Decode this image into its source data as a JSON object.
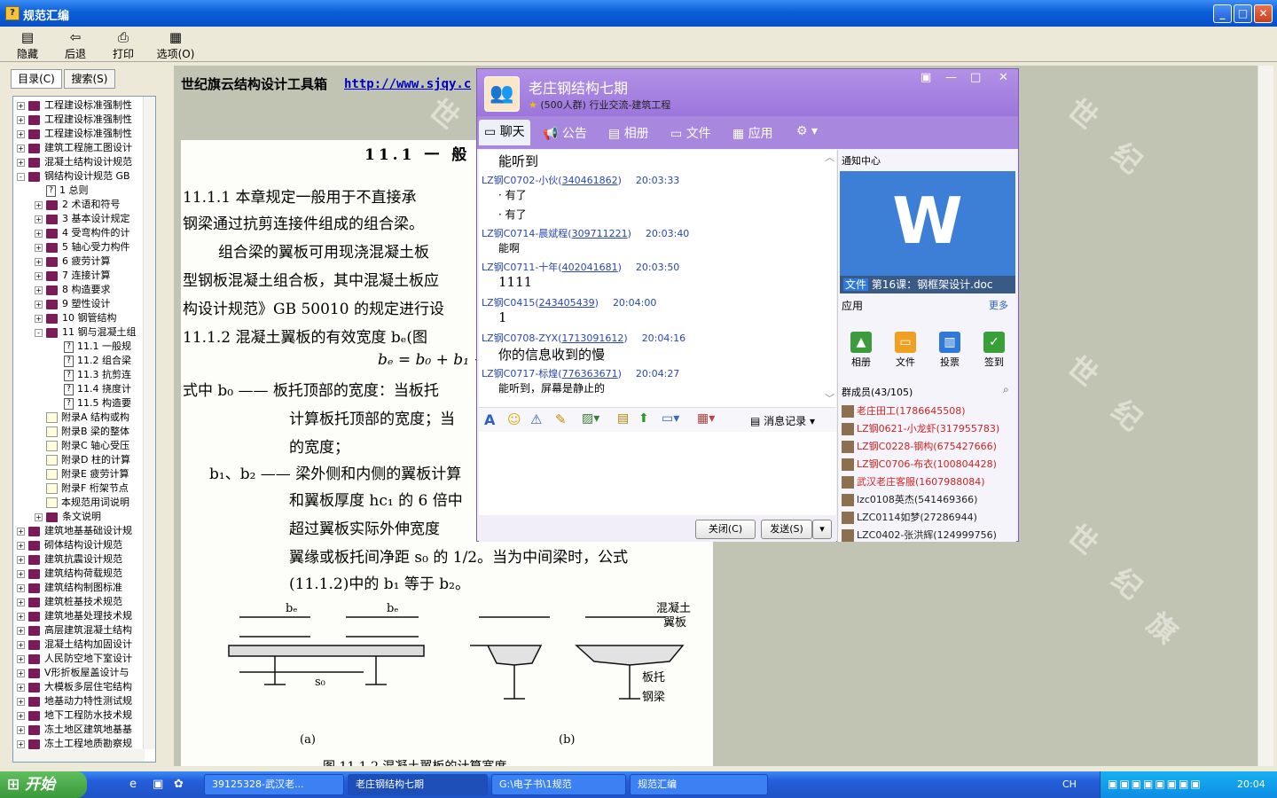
{
  "window": {
    "title": "规范汇编"
  },
  "toolbar": {
    "hide": "隐藏",
    "back": "后退",
    "print": "打印",
    "options": "选项(O)"
  },
  "left_tabs": {
    "contents": "目录(C)",
    "search": "搜索(S)"
  },
  "tree": [
    {
      "t": "工程建设标准强制性",
      "k": "book",
      "pm": "+",
      "lv": 0
    },
    {
      "t": "工程建设标准强制性",
      "k": "book",
      "pm": "+",
      "lv": 0
    },
    {
      "t": "工程建设标准强制性",
      "k": "book",
      "pm": "+",
      "lv": 0
    },
    {
      "t": "建筑工程施工图设计",
      "k": "book",
      "pm": "+",
      "lv": 0
    },
    {
      "t": "混凝土结构设计规范",
      "k": "book",
      "pm": "+",
      "lv": 0
    },
    {
      "t": "钢结构设计规范 GB",
      "k": "book",
      "pm": "-",
      "lv": 0
    },
    {
      "t": "1 总则",
      "k": "q",
      "pm": "",
      "lv": 1
    },
    {
      "t": "2 术语和符号",
      "k": "book",
      "pm": "+",
      "lv": 1
    },
    {
      "t": "3 基本设计规定",
      "k": "book",
      "pm": "+",
      "lv": 1
    },
    {
      "t": "4 受弯构件的计",
      "k": "book",
      "pm": "+",
      "lv": 1
    },
    {
      "t": "5 轴心受力构件",
      "k": "book",
      "pm": "+",
      "lv": 1
    },
    {
      "t": "6 疲劳计算",
      "k": "book",
      "pm": "+",
      "lv": 1
    },
    {
      "t": "7 连接计算",
      "k": "book",
      "pm": "+",
      "lv": 1
    },
    {
      "t": "8 构造要求",
      "k": "book",
      "pm": "+",
      "lv": 1
    },
    {
      "t": "9 塑性设计",
      "k": "book",
      "pm": "+",
      "lv": 1
    },
    {
      "t": "10 钢管结构",
      "k": "book",
      "pm": "+",
      "lv": 1
    },
    {
      "t": "11 钢与混凝土组",
      "k": "book",
      "pm": "-",
      "lv": 1
    },
    {
      "t": "11.1 一般规",
      "k": "q",
      "pm": "",
      "lv": 2
    },
    {
      "t": "11.2 组合梁",
      "k": "q",
      "pm": "",
      "lv": 2
    },
    {
      "t": "11.3 抗剪连",
      "k": "q",
      "pm": "",
      "lv": 2
    },
    {
      "t": "11.4 挠度计",
      "k": "q",
      "pm": "",
      "lv": 2
    },
    {
      "t": "11.5 构造要",
      "k": "q",
      "pm": "",
      "lv": 2
    },
    {
      "t": "附录A 结构或构",
      "k": "pg",
      "pm": "",
      "lv": 1
    },
    {
      "t": "附录B 梁的整体",
      "k": "pg",
      "pm": "",
      "lv": 1
    },
    {
      "t": "附录C 轴心受压",
      "k": "pg",
      "pm": "",
      "lv": 1
    },
    {
      "t": "附录D 柱的计算",
      "k": "pg",
      "pm": "",
      "lv": 1
    },
    {
      "t": "附录E 疲劳计算",
      "k": "pg",
      "pm": "",
      "lv": 1
    },
    {
      "t": "附录F 桁架节点",
      "k": "pg",
      "pm": "",
      "lv": 1
    },
    {
      "t": "本规范用词说明",
      "k": "pg",
      "pm": "",
      "lv": 1
    },
    {
      "t": "条文说明",
      "k": "book",
      "pm": "+",
      "lv": 1
    },
    {
      "t": "建筑地基基础设计规",
      "k": "book",
      "pm": "+",
      "lv": 0
    },
    {
      "t": "砌体结构设计规范",
      "k": "book",
      "pm": "+",
      "lv": 0
    },
    {
      "t": "建筑抗震设计规范",
      "k": "book",
      "pm": "+",
      "lv": 0
    },
    {
      "t": "建筑结构荷载规范",
      "k": "book",
      "pm": "+",
      "lv": 0
    },
    {
      "t": "建筑结构制图标准",
      "k": "book",
      "pm": "+",
      "lv": 0
    },
    {
      "t": "建筑桩基技术规范",
      "k": "book",
      "pm": "+",
      "lv": 0
    },
    {
      "t": "建筑地基处理技术规",
      "k": "book",
      "pm": "+",
      "lv": 0
    },
    {
      "t": "高层建筑混凝土结构",
      "k": "book",
      "pm": "+",
      "lv": 0
    },
    {
      "t": "混凝土结构加固设计",
      "k": "book",
      "pm": "+",
      "lv": 0
    },
    {
      "t": "人民防空地下室设计",
      "k": "book",
      "pm": "+",
      "lv": 0
    },
    {
      "t": "V形折板屋盖设计与",
      "k": "book",
      "pm": "+",
      "lv": 0
    },
    {
      "t": "大模板多层住宅结构",
      "k": "book",
      "pm": "+",
      "lv": 0
    },
    {
      "t": "地基动力特性测试规",
      "k": "book",
      "pm": "+",
      "lv": 0
    },
    {
      "t": "地下工程防水技术规",
      "k": "book",
      "pm": "+",
      "lv": 0
    },
    {
      "t": "冻土地区建筑地基基",
      "k": "book",
      "pm": "+",
      "lv": 0
    },
    {
      "t": "冻土工程地质勘察规",
      "k": "book",
      "pm": "+",
      "lv": 0
    }
  ],
  "doc": {
    "header": "世纪旗云结构设计工具箱",
    "link": "http://www.sjqy.c",
    "lines": [
      "11.1  一 般 规",
      "11.1.1  本章规定一般用于不直接承",
      "钢梁通过抗剪连接件组成的组合梁。",
      "组合梁的翼板可用现浇混凝土板",
      "型钢板混凝土组合板，其中混凝土板应",
      "构设计规范》GB 50010 的规定进行设",
      "11.1.2  混凝土翼板的有效宽度 bₑ(图",
      "bₑ = b₀ + b₁ +",
      "式中   b₀ —— 板托顶部的宽度：当板托",
      "计算板托顶部的宽度；当",
      "的宽度；",
      "b₁、b₂ —— 梁外侧和内侧的翼板计算",
      "和翼板厚度 hc₁ 的 6 倍中",
      "超过翼板实际外伸宽度",
      "翼缘或板托间净距 s₀ 的 1/2。当为中间梁时，公式",
      "(11.1.2)中的 b₁ 等于 b₂。"
    ],
    "fig_a": "(a)",
    "fig_b": "(b)",
    "fig_label1": "混凝土",
    "fig_label2": "翼板",
    "fig_label3": "板托",
    "fig_label4": "钢梁",
    "caption": "图 11.1.2  混凝土翼板的计算宽度"
  },
  "qq": {
    "group_name": "老庄钢结构七期",
    "group_sub": "(500人群) 行业交流-建筑工程",
    "tabs": [
      "聊天",
      "公告",
      "相册",
      "文件",
      "应用"
    ],
    "messages": [
      {
        "type": "text",
        "text": "能听到"
      },
      {
        "type": "meta",
        "name": "LZ钢C0702-小伙",
        "id": "340461862",
        "time": "20:03:33"
      },
      {
        "type": "text",
        "text": "· 有了"
      },
      {
        "type": "text",
        "text": "· 有了"
      },
      {
        "type": "meta",
        "name": "LZ钢C0714-晨斌程",
        "id": "309711221",
        "time": "20:03:40"
      },
      {
        "type": "text",
        "text": "能啊"
      },
      {
        "type": "meta",
        "name": "LZ钢C0711-十年",
        "id": "402041681",
        "time": "20:03:50"
      },
      {
        "type": "text",
        "text": "1111"
      },
      {
        "type": "meta",
        "name": "LZ钢C0415",
        "id": "243405439",
        "time": "20:04:00"
      },
      {
        "type": "text",
        "text": "1"
      },
      {
        "type": "meta",
        "name": "LZ钢C0708-ZYX",
        "id": "1713091612",
        "time": "20:04:16"
      },
      {
        "type": "text",
        "text": "你的信息收到的慢"
      },
      {
        "type": "meta",
        "name": "LZ钢C0717-标煌",
        "id": "776363671",
        "time": "20:04:27"
      },
      {
        "type": "text",
        "text": "能听到，屏幕是静止的"
      }
    ],
    "history_label": "消息记录",
    "close_btn": "关闭(C)",
    "send_btn": "发送(S)",
    "notify_title": "通知中心",
    "file_tag": "文件",
    "file_name": "第16课：钢框架设计.doc",
    "apps_title": "应用",
    "apps_more": "更多",
    "apps": [
      "相册",
      "文件",
      "投票",
      "签到"
    ],
    "members_title": "群成员(43/105)",
    "members": [
      {
        "n": "老庄田工(1786645508)",
        "c": "#d42020"
      },
      {
        "n": "LZ钢0621-小龙虾(317955783)",
        "c": "#d42020"
      },
      {
        "n": "LZ钢C0228-钢构(675427666)",
        "c": "#d42020"
      },
      {
        "n": "LZ钢C0706-布衣(100804428)",
        "c": "#d42020"
      },
      {
        "n": "武汉老庄客服(1607988084)",
        "c": "#d42020"
      },
      {
        "n": "lzc0108英杰(541469366)",
        "c": "#222"
      },
      {
        "n": "LZC0114如梦(27286944)",
        "c": "#222"
      },
      {
        "n": "LZC0402-张洪辉(124999756)",
        "c": "#222"
      }
    ]
  },
  "taskbar": {
    "start": "开始",
    "tasks": [
      "39125328-武汉老...",
      "老庄钢结构七期",
      "G:\\电子书\\1规范",
      "规范汇编"
    ],
    "lang": "CH",
    "clock": "20:04"
  }
}
